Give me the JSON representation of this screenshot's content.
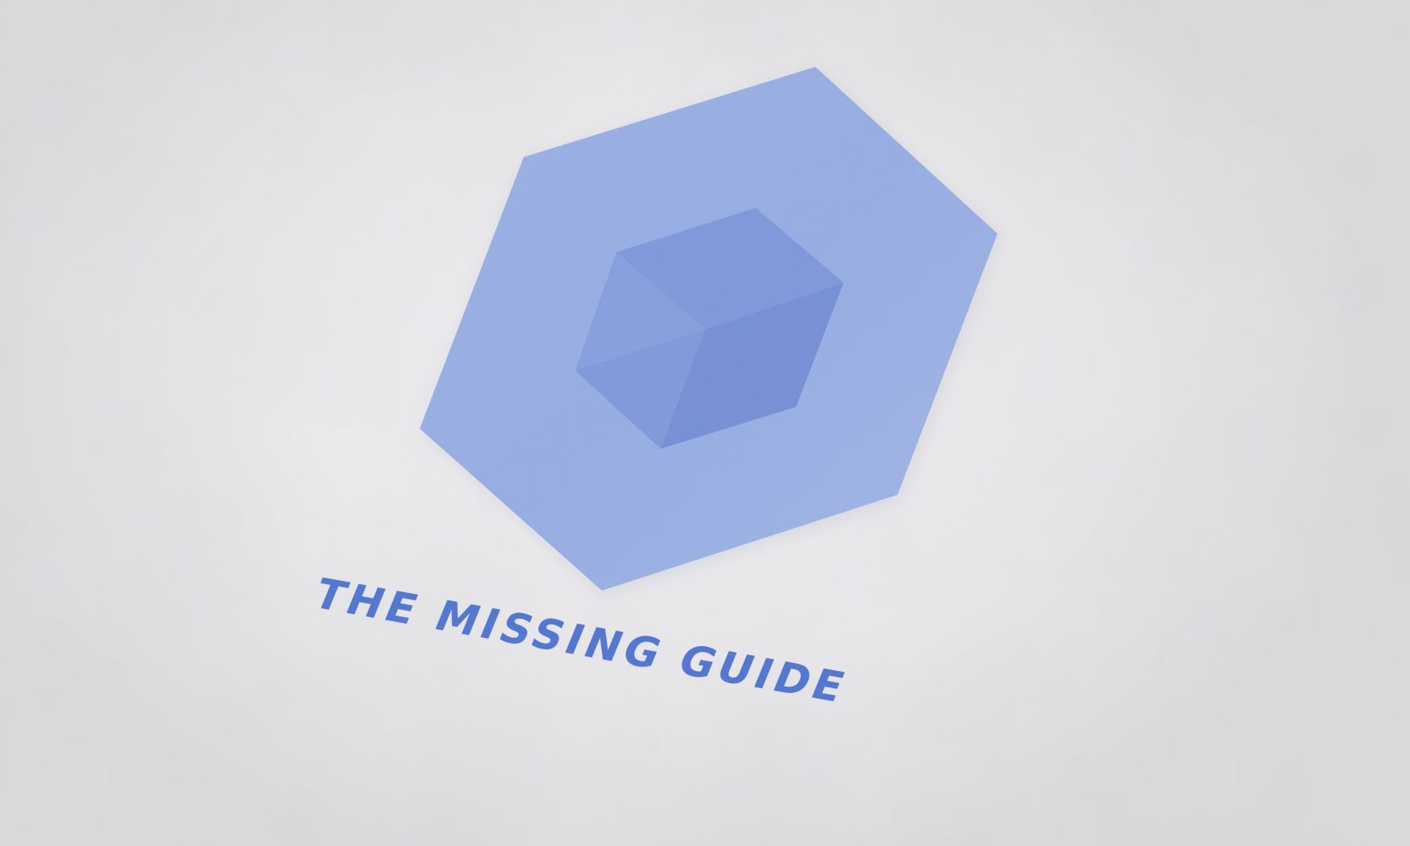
{
  "logo": {
    "wordmark": "THE MISSING GUIDE",
    "icon_name": "hexagon-cube-icon",
    "colors": {
      "paper": "#ecebed",
      "hexagon": "#8fa8e0",
      "cube": "#6f8dd8",
      "wordmark": "#4a6fcf"
    }
  }
}
